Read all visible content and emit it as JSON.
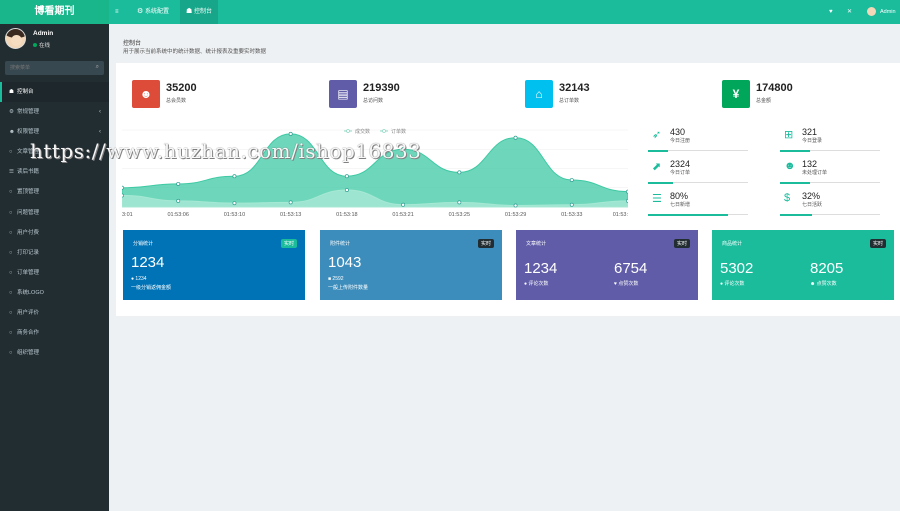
{
  "app": {
    "title": "博看期刊"
  },
  "topbar": {
    "menu_icon": "≡",
    "tabs": [
      {
        "label": "系统配置",
        "icon": "gear-icon"
      },
      {
        "label": "控制台",
        "icon": "dashboard-icon"
      }
    ],
    "user": "Admin"
  },
  "sidebar": {
    "user_name": "Admin",
    "status": "在线",
    "search_placeholder": "搜索菜单",
    "items": [
      {
        "label": "控制台",
        "icon": "dashboard-icon"
      },
      {
        "label": "常规管理",
        "icon": "cogs-icon"
      },
      {
        "label": "权限管理",
        "icon": "group-icon"
      },
      {
        "label": "文章管理",
        "icon": "circle-icon"
      },
      {
        "label": "读后书籍",
        "icon": "list-icon"
      },
      {
        "label": "置顶管理",
        "icon": "circle-icon"
      },
      {
        "label": "问题管理",
        "icon": "circle-icon"
      },
      {
        "label": "用户付费",
        "icon": "circle-icon"
      },
      {
        "label": "打印记录",
        "icon": "circle-icon"
      },
      {
        "label": "订单管理",
        "icon": "circle-icon"
      },
      {
        "label": "系统LOGO",
        "icon": "circle-icon"
      },
      {
        "label": "用户评价",
        "icon": "circle-icon"
      },
      {
        "label": "商务合作",
        "icon": "circle-icon"
      },
      {
        "label": "组织管理",
        "icon": "circle-icon"
      }
    ]
  },
  "header": {
    "title": "控制台",
    "subtitle": "用于展示当前系统中的统计数据、统计报表及重要实时数据"
  },
  "stats": [
    {
      "value": "35200",
      "label": "总会员数",
      "color": "#dd4b39",
      "icon": "users-icon"
    },
    {
      "value": "219390",
      "label": "总访问数",
      "color": "#605ca8",
      "icon": "book-icon"
    },
    {
      "value": "32143",
      "label": "总订单数",
      "color": "#00c0ef",
      "icon": "cart-icon"
    },
    {
      "value": "174800",
      "label": "总金额",
      "color": "#00a65a",
      "icon": "yen-icon"
    }
  ],
  "chart_data": {
    "type": "area",
    "legend": [
      "成交数",
      "订单数"
    ],
    "x": [
      "3:01",
      "01:53:06",
      "01:53:10",
      "01:53:13",
      "01:53:18",
      "01:53:21",
      "01:53:25",
      "01:53:29",
      "01:53:33",
      "01:53:"
    ],
    "series": [
      {
        "name": "成交数",
        "values": [
          15,
          8,
          5,
          6,
          22,
          3,
          6,
          2,
          3,
          8
        ]
      },
      {
        "name": "订单数",
        "values": [
          25,
          30,
          40,
          95,
          40,
          75,
          45,
          90,
          35,
          20
        ]
      }
    ],
    "colors": [
      "#a6e8d4",
      "#3ec9a4"
    ]
  },
  "mini_stats": [
    {
      "value": "430",
      "label": "今日注册",
      "icon": "rocket-icon",
      "progress": 0.2
    },
    {
      "value": "321",
      "label": "今日登录",
      "icon": "cart-icon",
      "progress": 0.3
    },
    {
      "value": "2324",
      "label": "今日订单",
      "icon": "chart-icon",
      "progress": 0.25
    },
    {
      "value": "132",
      "label": "未处理订单",
      "icon": "users-icon",
      "progress": 0.3
    },
    {
      "value": "80%",
      "label": "七日新增",
      "icon": "list-icon",
      "progress": 0.8
    },
    {
      "value": "32%",
      "label": "七日活跃",
      "icon": "dollar-icon",
      "progress": 0.32
    }
  ],
  "cards": [
    {
      "title": "分销统计",
      "badge": "实时",
      "big": "1234",
      "small": "1234",
      "foot": "一级分销返佣金额",
      "color": "#0073b7",
      "badge_color": "#1abc9c"
    },
    {
      "title": "附件统计",
      "badge": "实时",
      "big": "1043",
      "small": "2592",
      "foot": "一般上传附件数量",
      "color": "#3c8dbc",
      "badge_color": "#222d32"
    },
    {
      "title": "文章统计",
      "badge": "实时",
      "big1": "1234",
      "big2": "6754",
      "foot1": "评论次数",
      "foot2": "点赞次数",
      "color": "#605ca8",
      "badge_color": "#222d32"
    },
    {
      "title": "商品统计",
      "badge": "实时",
      "big1": "5302",
      "big2": "8205",
      "foot1": "评论次数",
      "foot2": "点赞次数",
      "color": "#1abc9c",
      "badge_color": "#222d32"
    }
  ],
  "watermark": "https://www.huzhan.com/ishop16833"
}
